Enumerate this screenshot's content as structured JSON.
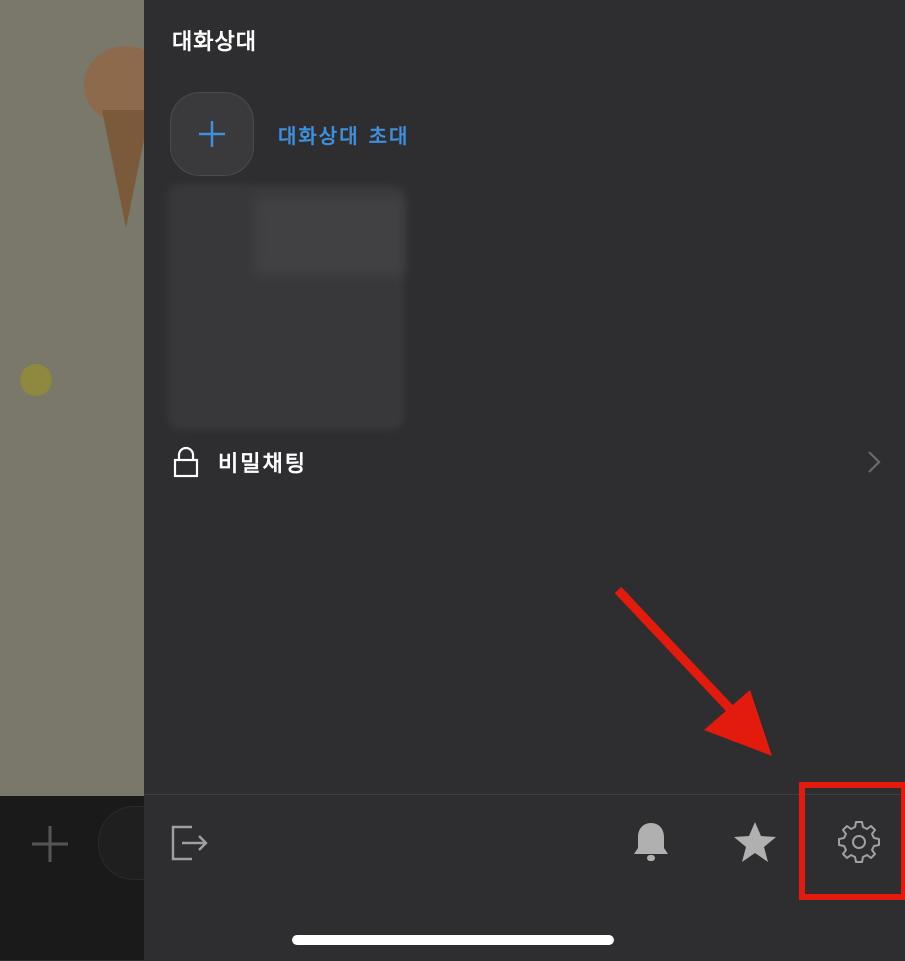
{
  "drawer": {
    "title": "대화상대",
    "invite_label": "대화상대 초대",
    "secret_chat_label": "비밀채팅"
  },
  "toolbar": {
    "icons": [
      "exit-icon",
      "bell-icon",
      "star-icon",
      "gear-icon"
    ]
  },
  "annotation": {
    "color": "#e21b0c",
    "target": "gear-icon"
  },
  "colors": {
    "drawer_bg": "#2e2e30",
    "accent": "#3f8fdc",
    "text": "#ffffff",
    "icon": "#b0b0b0"
  }
}
